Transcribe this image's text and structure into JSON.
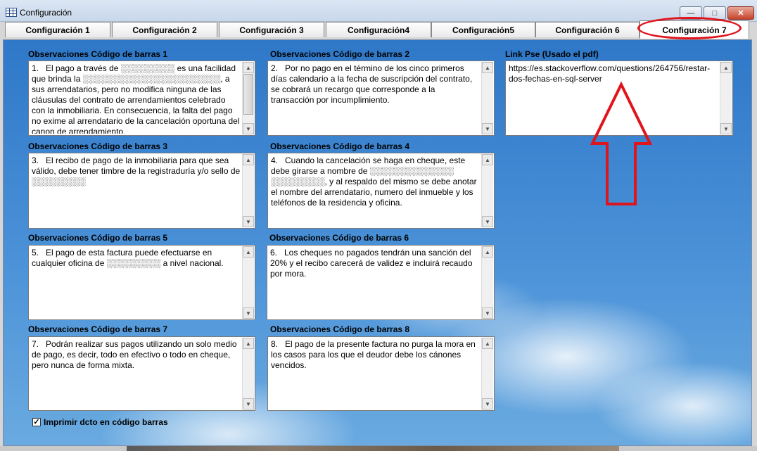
{
  "window": {
    "title": "Configuración",
    "minimize_glyph": "—",
    "maximize_glyph": "□",
    "close_glyph": "✕"
  },
  "tabs": [
    {
      "label": "Configuración 1"
    },
    {
      "label": "Configuración 2"
    },
    {
      "label": "Configuración 3"
    },
    {
      "label": "Configuración4"
    },
    {
      "label": "Configuración5"
    },
    {
      "label": "Configuración 6"
    },
    {
      "label": "Configuración 7"
    }
  ],
  "active_tab": "Configuración 7",
  "fields": {
    "obs1": {
      "label": "Observaciones Código de barras 1",
      "value": "1.   El pago a través de ░░░░░░░░░ es una facilidad que brinda la ░░░░░░░░░░░░░░░░░░░░░░░, a sus arrendatarios, pero no modifica ninguna de las cláusulas del contrato de arrendamientos celebrado con la inmobiliaria. En consecuencia, la falta del pago no exime al arrendatario de la cancelación oportuna del canon de arrendamiento."
    },
    "obs2": {
      "label": "Observaciones Código de barras 2",
      "value": "2.   Por no pago en el término de los cinco primeros días calendario a la fecha de suscripción del contrato, se cobrará un recargo que corresponde a la transacción por incumplimiento."
    },
    "link": {
      "label": "Link Pse (Usado el pdf)",
      "value": "https://es.stackoverflow.com/questions/264756/restar-dos-fechas-en-sql-server"
    },
    "obs3": {
      "label": "Observaciones Código de barras 3",
      "value": "3.   El recibo de pago de la inmobiliaria para que sea válido, debe tener timbre de la registraduría y/o sello de ░░░░░░░░░"
    },
    "obs4": {
      "label": "Observaciones Código de barras 4",
      "value": "4.   Cuando la cancelación se haga en cheque, este debe girarse a nombre de ░░░░░░░░░░░░░░ ░░░░░░░░░, y al respaldo del mismo se debe anotar el nombre del arrendatario, numero del inmueble y los teléfonos de la residencia y oficina."
    },
    "obs5": {
      "label": "Observaciones Código de barras 5",
      "value": "5.   El pago de esta factura puede efectuarse en cualquier oficina de ░░░░░░░░░ a nivel nacional."
    },
    "obs6": {
      "label": "Observaciones Código de barras 6",
      "value": "6.   Los cheques no pagados tendrán una sanción del 20% y el recibo carecerá de validez e incluirá recaudo por mora."
    },
    "obs7": {
      "label": "Observaciones Código de barras 7",
      "value": "7.   Podrán realizar sus pagos utilizando un solo medio de pago, es decir, todo en efectivo o todo en cheque, pero nunca de forma mixta."
    },
    "obs8": {
      "label": "Observaciones Código de barras 8",
      "value": "8.   El pago de la presente factura no purga la mora en los casos para los que el deudor debe los cánones vencidos."
    }
  },
  "checkbox": {
    "label": "Imprimir dcto en código barras",
    "checked": true,
    "check_glyph": "✓"
  },
  "scroll": {
    "up_glyph": "▲",
    "down_glyph": "▼"
  },
  "colors": {
    "annotation_red": "#e0141c",
    "sky_top": "#2f78c8"
  }
}
